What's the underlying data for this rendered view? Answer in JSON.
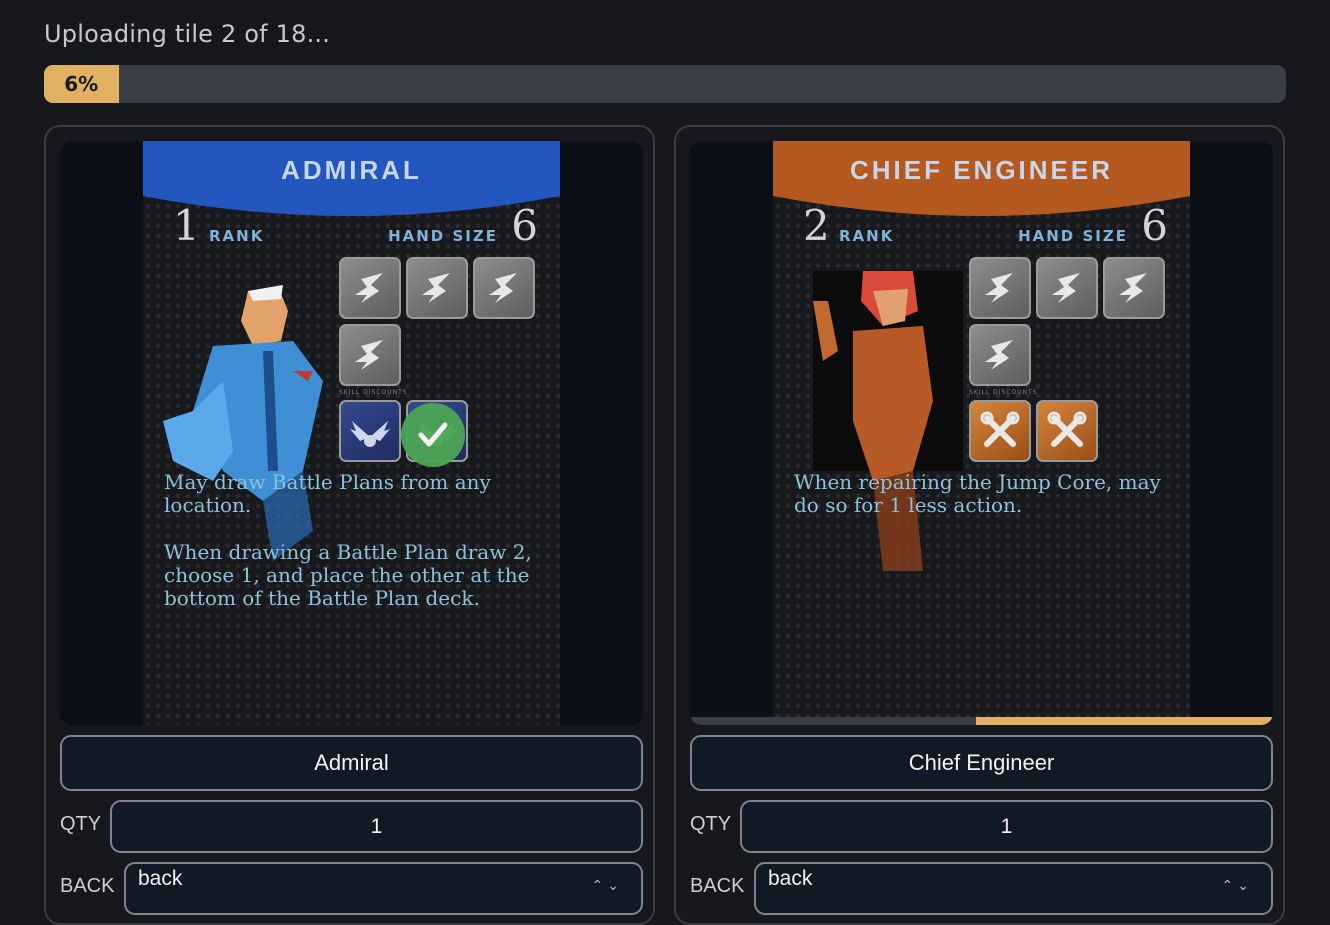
{
  "status": {
    "text": "Uploading tile 2 of 18..."
  },
  "progress": {
    "percent": 6,
    "label": "6%",
    "color": "#e1b060"
  },
  "tiles": [
    {
      "card": {
        "title": "Admiral",
        "banner_color": "#2456c0",
        "rank": "1",
        "rank_label": "Rank",
        "hand_label": "Hand Size",
        "hand_size": "6",
        "skill_discounts_label": "Skill Discounts",
        "ability_1": "May draw Battle Plans from any location.",
        "ability_2": "When drawing a Battle Plan draw 2, choose 1, and place the other at the bottom of the Battle Plan deck.",
        "extra_skill_icon": "wings-emblem-icon",
        "uploaded": true
      },
      "name": "Admiral",
      "qty_label": "QTY",
      "qty": "1",
      "back_label": "BACK",
      "back_value": "back"
    },
    {
      "card": {
        "title": "Chief Engineer",
        "banner_color": "#b45a20",
        "rank": "2",
        "rank_label": "Rank",
        "hand_label": "Hand Size",
        "hand_size": "6",
        "skill_discounts_label": "Skill Discounts",
        "ability_1": "When repairing the Jump Core, may do so for 1 less action.",
        "extra_skill_icon": "wrench-icon",
        "upload_progress": 0.51
      },
      "name": "Chief Engineer",
      "qty_label": "QTY",
      "qty": "1",
      "back_label": "BACK",
      "back_value": "back"
    }
  ]
}
